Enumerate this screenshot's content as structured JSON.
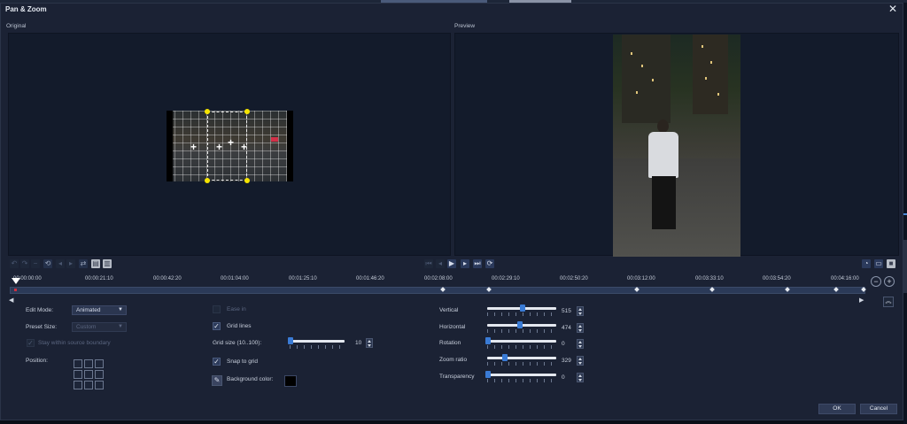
{
  "dialog": {
    "title": "Pan & Zoom",
    "close_glyph": "✕"
  },
  "panes": {
    "original_label": "Original",
    "preview_label": "Preview"
  },
  "timeline": {
    "timecodes": [
      "00:00:00:00",
      "00:00:21:10",
      "00:00:42:20",
      "00:01:04:00",
      "00:01:25:10",
      "00:01:46:20",
      "00:02:08:00",
      "00:02:29:10",
      "00:02:50:20",
      "00:03:12:00",
      "00:03:33:10",
      "00:03:54:20",
      "00:04:16:00"
    ]
  },
  "left_settings": {
    "edit_mode_label": "Edit Mode:",
    "edit_mode_value": "Animated",
    "preset_size_label": "Preset Size:",
    "preset_size_value": "Custom",
    "stay_within_label": "Stay within source boundary",
    "position_label": "Position:"
  },
  "middle_settings": {
    "ease_in_label": "Ease in",
    "grid_lines_label": "Grid lines",
    "grid_size_label": "Grid size (10..100):",
    "grid_size_value": "10",
    "snap_to_grid_label": "Snap to grid",
    "background_color_label": "Background color:",
    "background_color": "#000000"
  },
  "sliders": {
    "vertical_label": "Vertical",
    "vertical_value": "515",
    "horizontal_label": "Horizontal",
    "horizontal_value": "474",
    "rotation_label": "Rotation",
    "rotation_value": "0",
    "zoom_ratio_label": "Zoom ratio",
    "zoom_ratio_value": "329",
    "transparency_label": "Transparency",
    "transparency_value": "0"
  },
  "buttons": {
    "ok": "OK",
    "cancel": "Cancel"
  },
  "colors": {
    "accent": "#3a7bd5",
    "handle": "#f5e400",
    "dialog_bg": "#1b2234"
  }
}
